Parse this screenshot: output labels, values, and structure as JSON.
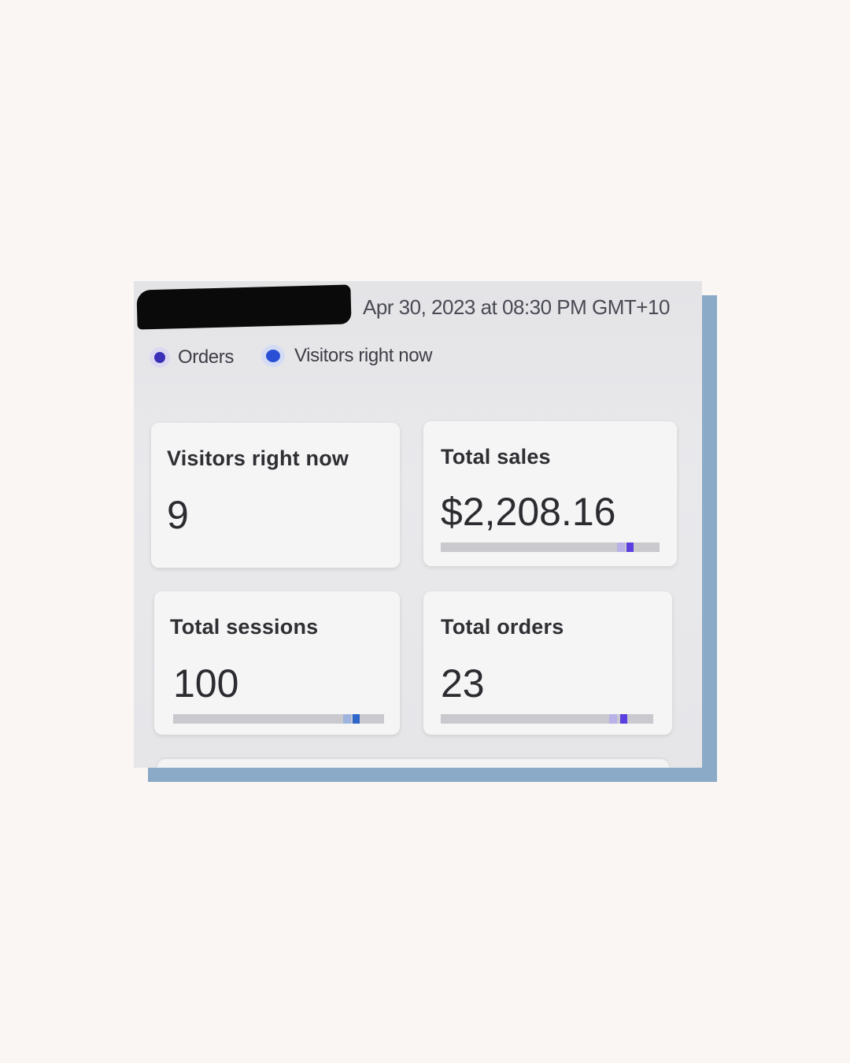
{
  "header": {
    "timestamp": "Apr 30, 2023 at 08:30 PM GMT+10"
  },
  "legend": [
    {
      "label": "Orders",
      "color": "#3b2fb8"
    },
    {
      "label": "Visitors right now",
      "color": "#2a4fd6"
    }
  ],
  "cards": {
    "visitors": {
      "title": "Visitors right now",
      "value": "9"
    },
    "sales": {
      "title": "Total sales",
      "value": "$2,208.16"
    },
    "sessions": {
      "title": "Total sessions",
      "value": "100"
    },
    "orders": {
      "title": "Total orders",
      "value": "23"
    }
  },
  "colors": {
    "page_background": "#faf6f3",
    "frame_shadow": "#8aaac8",
    "accent_purple": "#5b3fe0",
    "accent_blue": "#2f66c9"
  }
}
